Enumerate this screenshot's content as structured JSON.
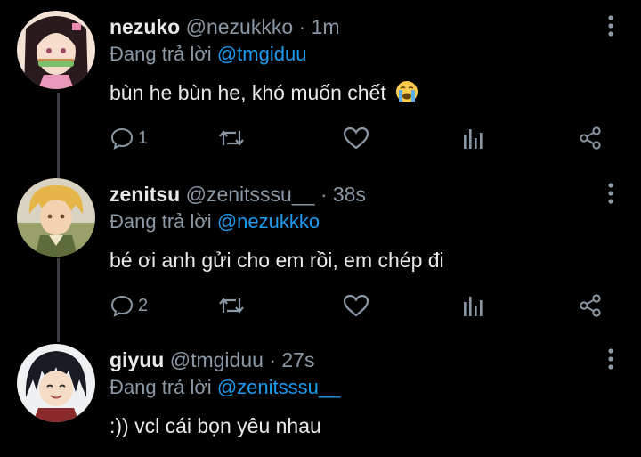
{
  "reply_prefix": "Đang trả lời",
  "tweets": [
    {
      "display_name": "nezuko",
      "handle": "@nezukkko",
      "separator": "·",
      "time": "1m",
      "reply_to": "@tmgiduu",
      "text": "bùn he bùn he, khó muốn chết",
      "emoji": "loudly-crying-face",
      "reply_count": "1"
    },
    {
      "display_name": "zenitsu",
      "handle": "@zenitsssu__",
      "separator": "·",
      "time": "38s",
      "reply_to": "@nezukkko",
      "text": "bé ơi anh gửi cho em rồi, em chép đi",
      "reply_count": "2"
    },
    {
      "display_name": "giyuu",
      "handle": "@tmgiduu",
      "separator": "·",
      "time": "27s",
      "reply_to": "@zenitsssu__",
      "text": ":)) vcl cái bọn yêu nhau"
    }
  ],
  "colors": {
    "background": "#000000",
    "text": "#e7e9ea",
    "secondary": "#8b98a5",
    "link": "#1d9bf0",
    "thread_line": "#3a3d41"
  }
}
